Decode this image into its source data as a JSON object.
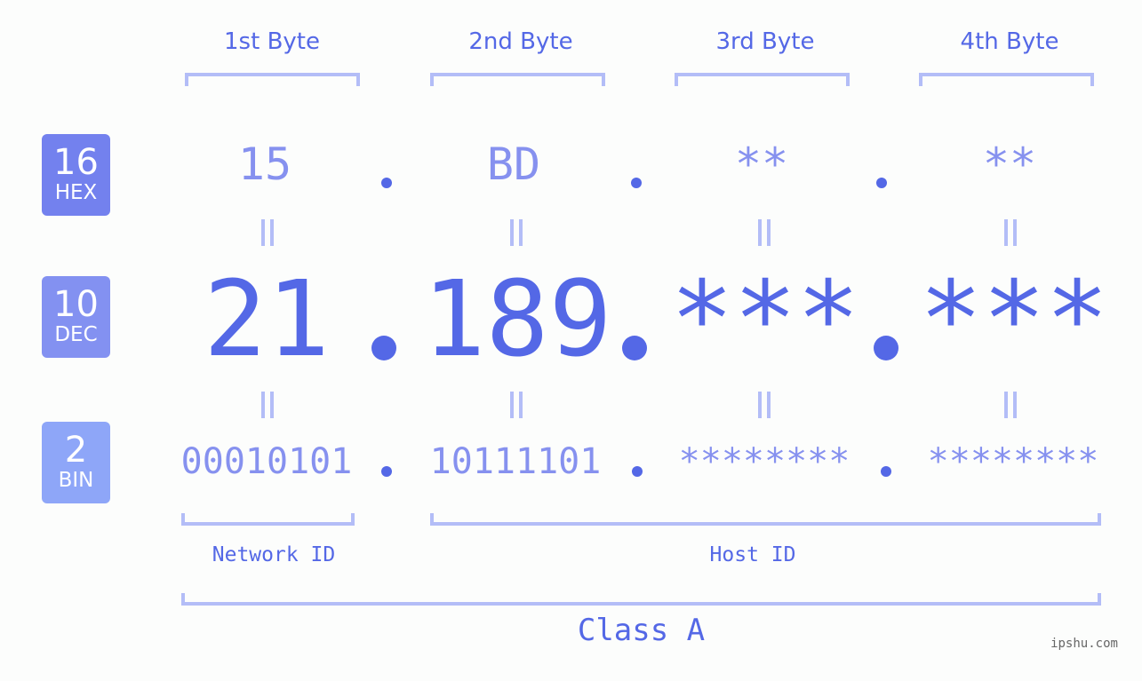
{
  "bytes": [
    {
      "header": "1st Byte",
      "hex": "15",
      "dec": "21",
      "bin": "00010101"
    },
    {
      "header": "2nd Byte",
      "hex": "BD",
      "dec": "189",
      "bin": "10111101"
    },
    {
      "header": "3rd Byte",
      "hex": "**",
      "dec": "***",
      "bin": "********"
    },
    {
      "header": "4th Byte",
      "hex": "**",
      "dec": "***",
      "bin": "********"
    }
  ],
  "badges": {
    "hex": {
      "num": "16",
      "label": "HEX",
      "color": "#7381ee"
    },
    "dec": {
      "num": "10",
      "label": "DEC",
      "color": "#8391f1"
    },
    "bin": {
      "num": "2",
      "label": "BIN",
      "color": "#8ea6f8"
    }
  },
  "ids": {
    "network": "Network ID",
    "host": "Host ID"
  },
  "class_label": "Class A",
  "watermark": "ipshu.com",
  "colors": {
    "primary": "#5468e6",
    "light": "#8691ef",
    "bracket": "#b3bdf7"
  }
}
